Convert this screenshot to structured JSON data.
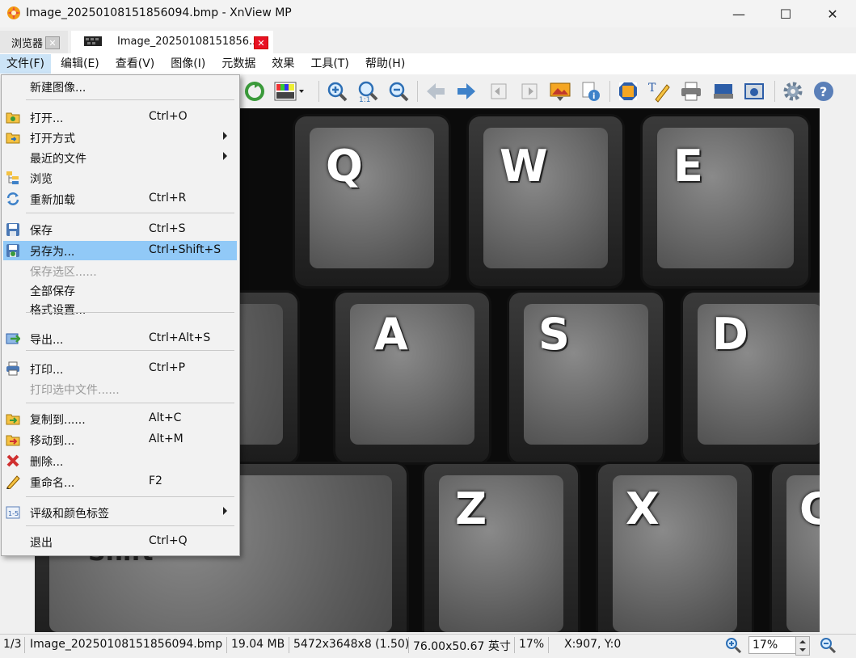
{
  "window": {
    "title": "Image_20250108151856094.bmp - XnView MP",
    "minimize": "—",
    "maximize": "☐",
    "close": "✕"
  },
  "tabs": [
    {
      "label": "浏览器"
    },
    {
      "label": "Image_20250108151856..."
    }
  ],
  "menubar": [
    "文件(F)",
    "编辑(E)",
    "查看(V)",
    "图像(I)",
    "元数据",
    "效果",
    "工具(T)",
    "帮助(H)"
  ],
  "file_menu": {
    "items": [
      {
        "label": "新建图像...",
        "shortcut": "",
        "icon": "none"
      },
      {
        "label": "打开...",
        "shortcut": "Ctrl+O",
        "icon": "open-folder-icon"
      },
      {
        "label": "打开方式",
        "shortcut": "",
        "icon": "open-with-icon",
        "submenu": true
      },
      {
        "label": "最近的文件",
        "shortcut": "",
        "icon": "none",
        "submenu": true
      },
      {
        "label": "浏览",
        "shortcut": "",
        "icon": "browse-tree-icon"
      },
      {
        "label": "重新加载",
        "shortcut": "Ctrl+R",
        "icon": "reload-icon"
      },
      {
        "label": "保存",
        "shortcut": "Ctrl+S",
        "icon": "save-icon"
      },
      {
        "label": "另存为...",
        "shortcut": "Ctrl+Shift+S",
        "icon": "save-as-icon",
        "highlighted": true
      },
      {
        "label": "保存选区......",
        "shortcut": "",
        "icon": "none",
        "disabled": true
      },
      {
        "label": "全部保存",
        "shortcut": "",
        "icon": "none"
      },
      {
        "label": "格式设置...",
        "shortcut": "",
        "icon": "none"
      },
      {
        "label": "导出...",
        "shortcut": "Ctrl+Alt+S",
        "icon": "export-icon"
      },
      {
        "label": "打印...",
        "shortcut": "Ctrl+P",
        "icon": "print-icon"
      },
      {
        "label": "打印选中文件......",
        "shortcut": "",
        "icon": "none",
        "disabled": true
      },
      {
        "label": "复制到......",
        "shortcut": "Alt+C",
        "icon": "copy-to-icon"
      },
      {
        "label": "移动到...",
        "shortcut": "Alt+M",
        "icon": "move-to-icon"
      },
      {
        "label": "删除...",
        "shortcut": "",
        "icon": "delete-icon"
      },
      {
        "label": "重命名...",
        "shortcut": "F2",
        "icon": "rename-icon"
      },
      {
        "label": "评级和颜色标签",
        "shortcut": "",
        "icon": "rating-icon",
        "submenu": true
      },
      {
        "label": "退出",
        "shortcut": "Ctrl+Q",
        "icon": "none"
      }
    ]
  },
  "image": {
    "keys": [
      "Q",
      "W",
      "E",
      "A",
      "S",
      "D",
      "Z",
      "X",
      "C"
    ],
    "shift_text": "Shift"
  },
  "status": {
    "page": "1/3",
    "filename": "Image_20250108151856094.bmp",
    "filesize": "19.04 MB",
    "dimensions": "5472x3648x8 (1.50)",
    "physical_size": "76.00x50.67 英寸",
    "zoom_pct": "17%",
    "coords": "X:907, Y:0",
    "zoom_value": "17%"
  },
  "colors": {
    "menu_highlight": "#91c9f7",
    "menubar_active": "#cce4f7",
    "close_tab": "#e81123"
  }
}
